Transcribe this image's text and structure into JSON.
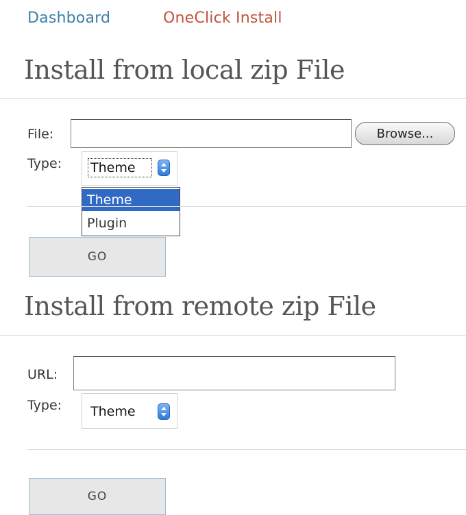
{
  "breadcrumb": {
    "dashboard": "Dashboard",
    "oneclick": "OneClick Install"
  },
  "local_section": {
    "heading": "Install from local zip File",
    "file_label": "File:",
    "file_value": "",
    "browse_label": "Browse...",
    "type_label": "Type:",
    "type_selected": "Theme",
    "type_options": [
      "Theme",
      "Plugin"
    ],
    "highlighted_option": "Theme",
    "go_label": "GO"
  },
  "remote_section": {
    "heading": "Install from remote zip File",
    "url_label": "URL:",
    "url_value": "",
    "type_label": "Type:",
    "type_selected": "Theme",
    "go_label": "GO"
  },
  "colors": {
    "link_blue": "#3d7fa8",
    "link_red": "#c0533c",
    "selection": "#316ac5",
    "stepper": "#2f7bdc"
  }
}
